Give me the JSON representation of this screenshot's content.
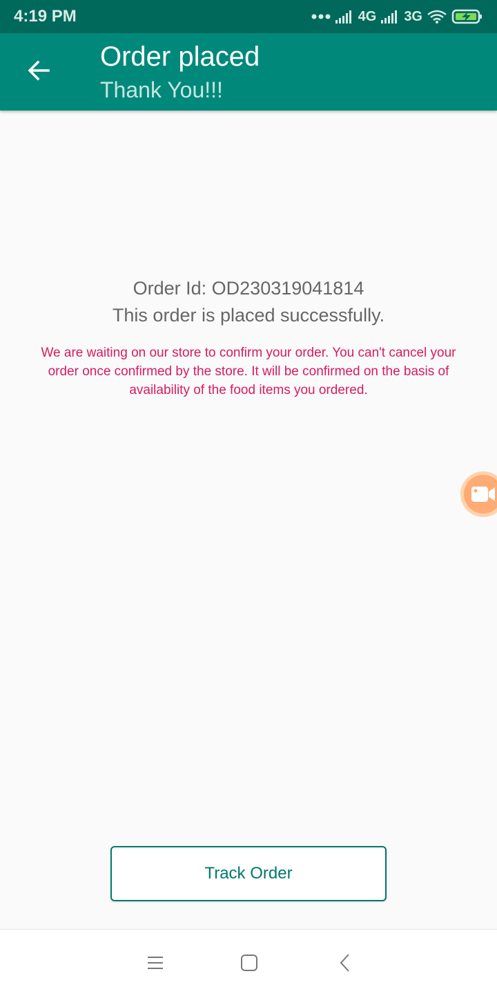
{
  "status_bar": {
    "time": "4:19 PM",
    "network_1": "4G",
    "network_2": "3G",
    "icons": [
      "more-dots-icon",
      "signal-icon",
      "signal-icon",
      "wifi-icon",
      "battery-charging-icon"
    ]
  },
  "app_bar": {
    "title": "Order placed",
    "subtitle": "Thank You!!!",
    "back_icon": "arrow-back-icon",
    "color": "#00897b",
    "status_color": "#00695c"
  },
  "order": {
    "id_text": "Order Id: OD230319041814",
    "status_text": "This order is placed successfully.",
    "notice": "We are waiting on our store to confirm your order. You can't cancel your order once confirmed by the store. It will be confirmed on the basis of availability of the food items you ordered.",
    "notice_color": "#d81b60"
  },
  "fab": {
    "icon": "video-camera-icon",
    "color": "#ffab74"
  },
  "actions": {
    "track_order_label": "Track Order",
    "accent": "#00796b"
  },
  "nav_bar": {
    "icons": [
      "menu-icon",
      "home-square-icon",
      "back-chevron-icon"
    ]
  }
}
